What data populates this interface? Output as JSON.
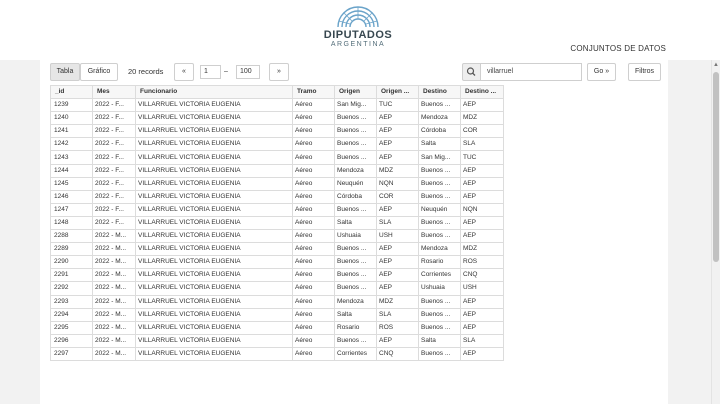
{
  "header": {
    "logo_title": "DIPUTADOS",
    "logo_sub": "ARGENTINA",
    "link": "CONJUNTOS DE DATOS"
  },
  "toolbar": {
    "tab_table": "Tabla",
    "tab_chart": "Gráfico",
    "records_label": "20 records",
    "prev_label": "«",
    "page_from": "1",
    "dash": "–",
    "page_to": "100",
    "next_label": "»",
    "search_value": "villarruel",
    "go_label": "Go »",
    "filters_label": "Filtros"
  },
  "colors": {
    "accent": "#6aa3c9",
    "border": "#dcdcdc",
    "sidebar": "#f2f2f2"
  },
  "table": {
    "columns": [
      "_id",
      "Mes",
      "Funcionario",
      "Tramo",
      "Origen",
      "Origen ...",
      "Destino",
      "Destino ..."
    ],
    "rows": [
      [
        "1239",
        "2022 - F...",
        "VILLARRUEL VICTORIA EUGENIA",
        "Aéreo",
        "San Mig...",
        "TUC",
        "Buenos ...",
        "AEP"
      ],
      [
        "1240",
        "2022 - F...",
        "VILLARRUEL VICTORIA EUGENIA",
        "Aéreo",
        "Buenos ...",
        "AEP",
        "Mendoza",
        "MDZ"
      ],
      [
        "1241",
        "2022 - F...",
        "VILLARRUEL VICTORIA EUGENIA",
        "Aéreo",
        "Buenos ...",
        "AEP",
        "Córdoba",
        "COR"
      ],
      [
        "1242",
        "2022 - F...",
        "VILLARRUEL VICTORIA EUGENIA",
        "Aéreo",
        "Buenos ...",
        "AEP",
        "Salta",
        "SLA"
      ],
      [
        "1243",
        "2022 - F...",
        "VILLARRUEL VICTORIA EUGENIA",
        "Aéreo",
        "Buenos ...",
        "AEP",
        "San Mig...",
        "TUC"
      ],
      [
        "1244",
        "2022 - F...",
        "VILLARRUEL VICTORIA EUGENIA",
        "Aéreo",
        "Mendoza",
        "MDZ",
        "Buenos ...",
        "AEP"
      ],
      [
        "1245",
        "2022 - F...",
        "VILLARRUEL VICTORIA EUGENIA",
        "Aéreo",
        "Neuquén",
        "NQN",
        "Buenos ...",
        "AEP"
      ],
      [
        "1246",
        "2022 - F...",
        "VILLARRUEL VICTORIA EUGENIA",
        "Aéreo",
        "Córdoba",
        "COR",
        "Buenos ...",
        "AEP"
      ],
      [
        "1247",
        "2022 - F...",
        "VILLARRUEL VICTORIA EUGENIA",
        "Aéreo",
        "Buenos ...",
        "AEP",
        "Neuquén",
        "NQN"
      ],
      [
        "1248",
        "2022 - F...",
        "VILLARRUEL VICTORIA EUGENIA",
        "Aéreo",
        "Salta",
        "SLA",
        "Buenos ...",
        "AEP"
      ],
      [
        "2288",
        "2022 - M...",
        "VILLARRUEL VICTORIA EUGENIA",
        "Aéreo",
        "Ushuaia",
        "USH",
        "Buenos ...",
        "AEP"
      ],
      [
        "2289",
        "2022 - M...",
        "VILLARRUEL VICTORIA EUGENIA",
        "Aéreo",
        "Buenos ...",
        "AEP",
        "Mendoza",
        "MDZ"
      ],
      [
        "2290",
        "2022 - M...",
        "VILLARRUEL VICTORIA EUGENIA",
        "Aéreo",
        "Buenos ...",
        "AEP",
        "Rosario",
        "ROS"
      ],
      [
        "2291",
        "2022 - M...",
        "VILLARRUEL VICTORIA EUGENIA",
        "Aéreo",
        "Buenos ...",
        "AEP",
        "Corrientes",
        "CNQ"
      ],
      [
        "2292",
        "2022 - M...",
        "VILLARRUEL VICTORIA EUGENIA",
        "Aéreo",
        "Buenos ...",
        "AEP",
        "Ushuaia",
        "USH"
      ],
      [
        "2293",
        "2022 - M...",
        "VILLARRUEL VICTORIA EUGENIA",
        "Aéreo",
        "Mendoza",
        "MDZ",
        "Buenos ...",
        "AEP"
      ],
      [
        "2294",
        "2022 - M...",
        "VILLARRUEL VICTORIA EUGENIA",
        "Aéreo",
        "Salta",
        "SLA",
        "Buenos ...",
        "AEP"
      ],
      [
        "2295",
        "2022 - M...",
        "VILLARRUEL VICTORIA EUGENIA",
        "Aéreo",
        "Rosario",
        "ROS",
        "Buenos ...",
        "AEP"
      ],
      [
        "2296",
        "2022 - M...",
        "VILLARRUEL VICTORIA EUGENIA",
        "Aéreo",
        "Buenos ...",
        "AEP",
        "Salta",
        "SLA"
      ],
      [
        "2297",
        "2022 - M...",
        "VILLARRUEL VICTORIA EUGENIA",
        "Aéreo",
        "Corrientes",
        "CNQ",
        "Buenos ...",
        "AEP"
      ]
    ]
  }
}
